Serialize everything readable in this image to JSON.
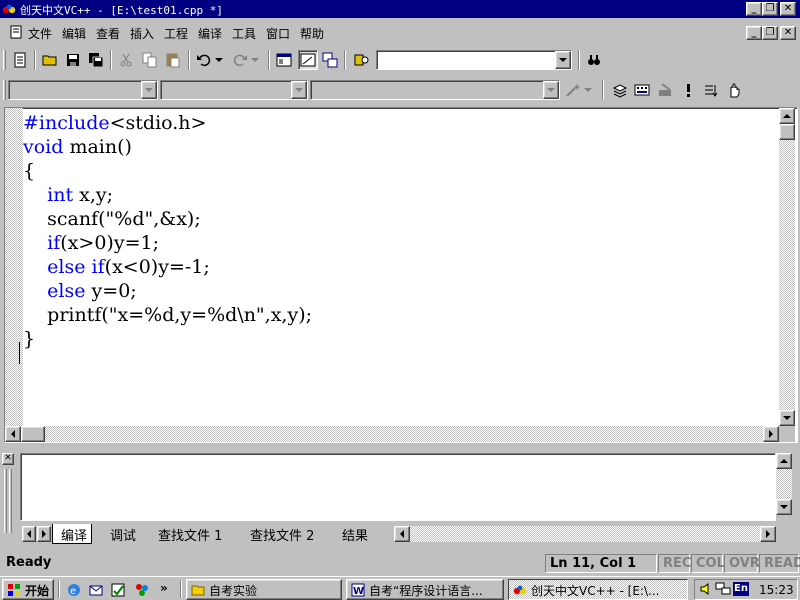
{
  "window": {
    "title": "创天中文VC++ - [E:\\test01.cpp *]"
  },
  "menu": [
    "文件",
    "编辑",
    "查看",
    "插入",
    "工程",
    "编译",
    "工具",
    "窗口",
    "帮助"
  ],
  "code_lines": [
    [
      {
        "t": "#include",
        "k": true
      },
      {
        "t": "<stdio.h>"
      }
    ],
    [
      {
        "t": "void",
        "k": true
      },
      {
        "t": " main()"
      }
    ],
    [
      {
        "t": "{"
      }
    ],
    [
      {
        "t": "    "
      },
      {
        "t": "int",
        "k": true
      },
      {
        "t": " x,y;"
      }
    ],
    [
      {
        "t": "    scanf(\"%d\",&x);"
      }
    ],
    [
      {
        "t": "    "
      },
      {
        "t": "if",
        "k": true
      },
      {
        "t": "(x>0)y=1;"
      }
    ],
    [
      {
        "t": "    "
      },
      {
        "t": "else",
        "k": true
      },
      {
        "t": " "
      },
      {
        "t": "if",
        "k": true
      },
      {
        "t": "(x<0)y=-1;"
      }
    ],
    [
      {
        "t": "    "
      },
      {
        "t": "else",
        "k": true
      },
      {
        "t": " y=0;"
      }
    ],
    [
      {
        "t": "    printf(\"x=%d,y=%d\\n\",x,y);"
      }
    ],
    [
      {
        "t": "}"
      }
    ]
  ],
  "output_tabs": [
    "编译",
    "调试",
    "查找文件 1",
    "查找文件 2",
    "结果"
  ],
  "status": {
    "ready": "Ready",
    "position": "Ln 11, Col 1",
    "indicators": [
      "REC",
      "COL",
      "OVR",
      "READ"
    ]
  },
  "taskbar": {
    "start": "开始",
    "tasks": [
      {
        "label": "自考实验",
        "icon": "folder-icon"
      },
      {
        "label": "自考“程序设计语言...",
        "icon": "word-icon"
      },
      {
        "label": "创天中文VC++ - [E:\\...",
        "icon": "vc-icon",
        "active": true
      }
    ],
    "tray": {
      "lang": "En",
      "time": "15:23"
    }
  }
}
